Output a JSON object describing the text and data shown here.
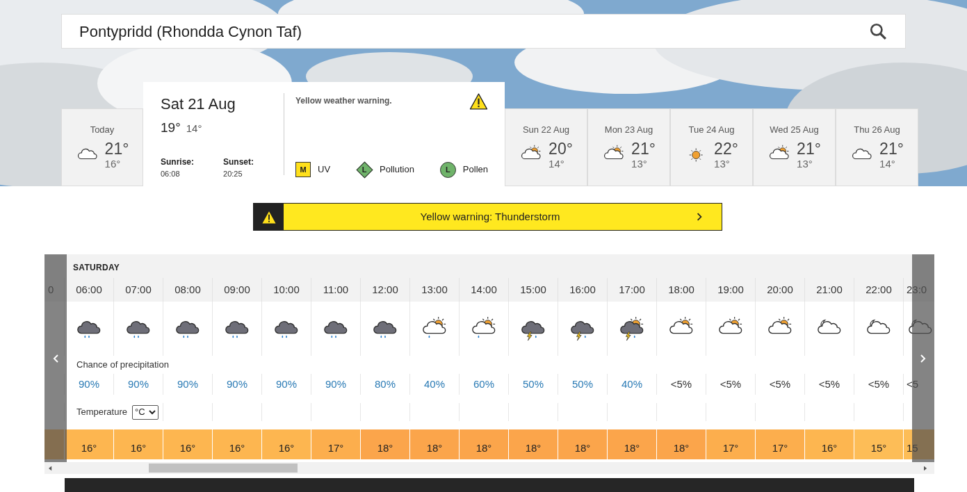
{
  "search": {
    "value": "Pontypridd (Rhondda Cynon Taf)"
  },
  "days": [
    {
      "label": "Today",
      "kind": "cloud",
      "high": "21°",
      "low": "16°",
      "selected": false
    },
    {
      "label": "Sat 21 Aug",
      "high": "19°",
      "low": "14°",
      "selected": true,
      "sunrise_label": "Sunrise:",
      "sunrise": "06:08",
      "sunset_label": "Sunset:",
      "sunset": "20:25",
      "warning": "Yellow weather warning.",
      "indices": [
        {
          "kind": "square",
          "code": "M",
          "label": "UV",
          "color": "#ffe01b"
        },
        {
          "kind": "diamond",
          "code": "L",
          "label": "Pollution",
          "color": "#6fb36a"
        },
        {
          "kind": "circle",
          "code": "L",
          "label": "Pollen",
          "color": "#6fb36a"
        }
      ]
    },
    {
      "label": "Sun 22 Aug",
      "kind": "sun-cloud",
      "high": "20°",
      "low": "14°",
      "selected": false
    },
    {
      "label": "Mon 23 Aug",
      "kind": "sun-cloud",
      "high": "21°",
      "low": "13°",
      "selected": false
    },
    {
      "label": "Tue 24 Aug",
      "kind": "sun",
      "high": "22°",
      "low": "13°",
      "selected": false
    },
    {
      "label": "Wed 25 Aug",
      "kind": "sun-cloud",
      "high": "21°",
      "low": "13°",
      "selected": false
    },
    {
      "label": "Thu 26 Aug",
      "kind": "cloud",
      "high": "21°",
      "low": "14°",
      "selected": false
    }
  ],
  "warning_bar": {
    "text": "Yellow warning: Thunderstorm"
  },
  "hourly": {
    "day": "SATURDAY",
    "precip_label": "Chance of precipitation",
    "temp_label": "Temperature",
    "unit": "°C",
    "hours": [
      {
        "time": "0"
      },
      {
        "time": "06:00",
        "kind": "rain",
        "precip": "90%",
        "highlight": true,
        "temp": "16°",
        "color": "#fdb650"
      },
      {
        "time": "07:00",
        "kind": "rain",
        "precip": "90%",
        "highlight": true,
        "temp": "16°",
        "color": "#fdb650"
      },
      {
        "time": "08:00",
        "kind": "rain",
        "precip": "90%",
        "highlight": true,
        "temp": "16°",
        "color": "#fdb650"
      },
      {
        "time": "09:00",
        "kind": "rain",
        "precip": "90%",
        "highlight": true,
        "temp": "16°",
        "color": "#fdb650"
      },
      {
        "time": "10:00",
        "kind": "rain",
        "precip": "90%",
        "highlight": true,
        "temp": "16°",
        "color": "#fdb650"
      },
      {
        "time": "11:00",
        "kind": "rain",
        "precip": "90%",
        "highlight": true,
        "temp": "17°",
        "color": "#fcae4d"
      },
      {
        "time": "12:00",
        "kind": "rain",
        "precip": "80%",
        "highlight": true,
        "temp": "18°",
        "color": "#fba54b"
      },
      {
        "time": "13:00",
        "kind": "sun-cloud-rain",
        "precip": "40%",
        "highlight": true,
        "temp": "18°",
        "color": "#fba54b"
      },
      {
        "time": "14:00",
        "kind": "sun-cloud-rain",
        "precip": "60%",
        "highlight": true,
        "temp": "18°",
        "color": "#fba54b"
      },
      {
        "time": "15:00",
        "kind": "thunder",
        "precip": "50%",
        "highlight": true,
        "temp": "18°",
        "color": "#fba54b"
      },
      {
        "time": "16:00",
        "kind": "thunder",
        "precip": "50%",
        "highlight": true,
        "temp": "18°",
        "color": "#fba54b"
      },
      {
        "time": "17:00",
        "kind": "sun-thunder",
        "precip": "40%",
        "highlight": true,
        "temp": "18°",
        "color": "#fba54b"
      },
      {
        "time": "18:00",
        "kind": "sun-cloud",
        "precip": "<5%",
        "highlight": false,
        "temp": "18°",
        "color": "#fba54b"
      },
      {
        "time": "19:00",
        "kind": "sun-cloud",
        "precip": "<5%",
        "highlight": false,
        "temp": "17°",
        "color": "#fcae4d"
      },
      {
        "time": "20:00",
        "kind": "sun-cloud",
        "precip": "<5%",
        "highlight": false,
        "temp": "17°",
        "color": "#fcae4d"
      },
      {
        "time": "21:00",
        "kind": "moon-cloud",
        "precip": "<5%",
        "highlight": false,
        "temp": "16°",
        "color": "#fdb650"
      },
      {
        "time": "22:00",
        "kind": "moon-cloud",
        "precip": "<5%",
        "highlight": false,
        "temp": "15°",
        "color": "#fdbd57"
      },
      {
        "time": "23:0",
        "kind": "moon-cloud",
        "precip": "<5",
        "highlight": false,
        "temp": "15",
        "color": "#fdbd57"
      }
    ]
  }
}
